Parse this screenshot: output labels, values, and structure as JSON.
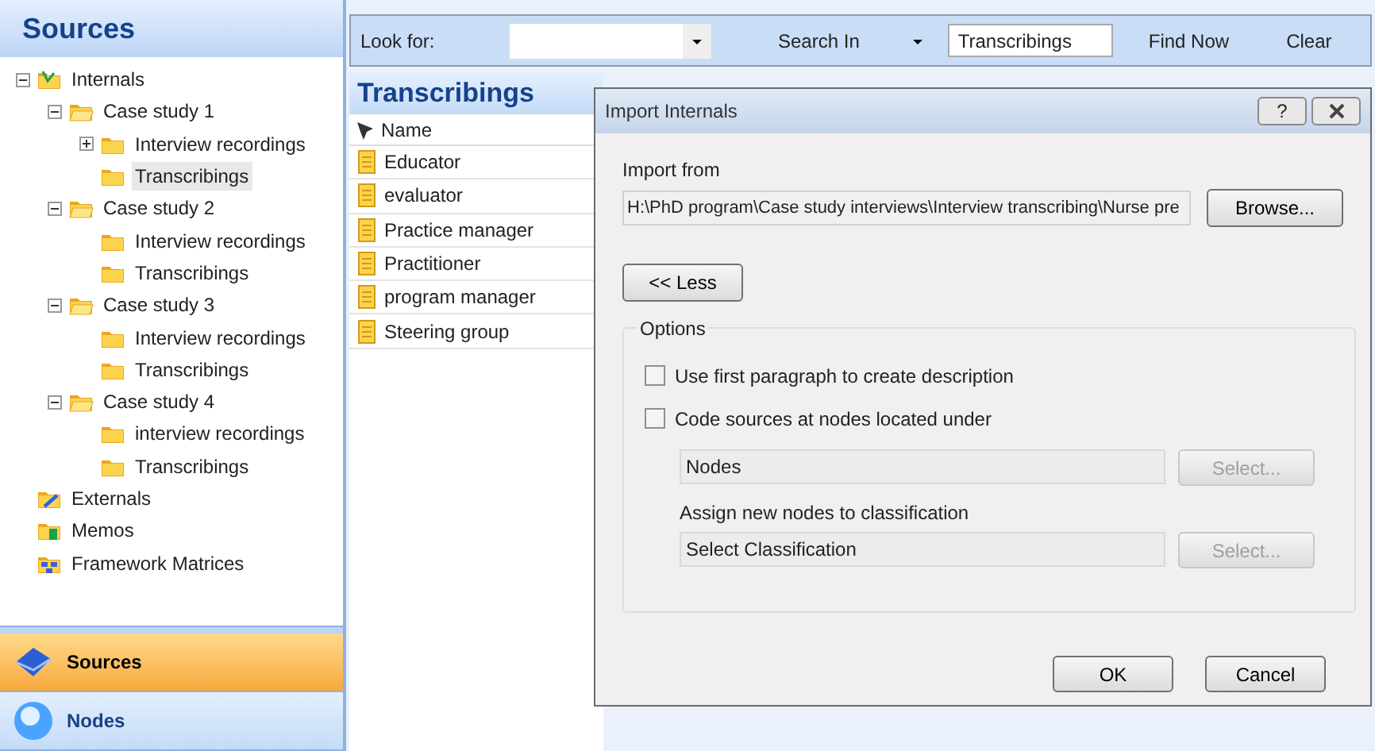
{
  "sidebar": {
    "title": "Sources",
    "tree": [
      {
        "label": "Internals",
        "kind": "root",
        "expanded": true,
        "selected": false,
        "children": [
          {
            "label": "Case study 1",
            "kind": "open",
            "expanded": true,
            "selected": false,
            "children": [
              {
                "label": "Interview recordings",
                "kind": "folder",
                "expanded": false,
                "selected": false
              },
              {
                "label": "Transcribings",
                "kind": "folder",
                "selected": true
              }
            ]
          },
          {
            "label": "Case study 2",
            "kind": "open",
            "expanded": true,
            "selected": false,
            "children": [
              {
                "label": "Interview recordings",
                "kind": "folder",
                "selected": false
              },
              {
                "label": "Transcribings",
                "kind": "folder",
                "selected": false
              }
            ]
          },
          {
            "label": "Case study 3",
            "kind": "open",
            "expanded": true,
            "selected": false,
            "children": [
              {
                "label": "Interview recordings",
                "kind": "folder",
                "selected": false
              },
              {
                "label": "Transcribings",
                "kind": "folder",
                "selected": false
              }
            ]
          },
          {
            "label": "Case study 4",
            "kind": "open",
            "expanded": true,
            "selected": false,
            "children": [
              {
                "label": "interview recordings",
                "kind": "folder",
                "selected": false
              },
              {
                "label": "Transcribings",
                "kind": "folder",
                "selected": false
              }
            ]
          }
        ]
      },
      {
        "label": "Externals",
        "kind": "externals",
        "selected": false
      },
      {
        "label": "Memos",
        "kind": "memos",
        "selected": false
      },
      {
        "label": "Framework Matrices",
        "kind": "matrices",
        "selected": false
      }
    ],
    "nav": [
      {
        "label": "Sources",
        "kind": "cube",
        "selected": true
      },
      {
        "label": "Nodes",
        "kind": "sphere",
        "selected": false
      }
    ]
  },
  "toolbar": {
    "look_for_label": "Look for:",
    "search_in_label": "Search In",
    "search_in_value": "Transcribings",
    "find_now": "Find Now",
    "clear": "Clear"
  },
  "list": {
    "title": "Transcribings",
    "columns": [
      "Name"
    ],
    "rows": [
      "Educator",
      "evaluator",
      "Practice manager",
      "Practitioner",
      "program manager",
      "Steering group"
    ]
  },
  "dialog": {
    "title": "Import Internals",
    "help": "?",
    "import_from_label": "Import from",
    "path": "H:\\PhD program\\Case study interviews\\Interview transcribing\\Nurse pre",
    "browse": "Browse...",
    "less": "<< Less",
    "options_label": "Options",
    "checkboxes": [
      {
        "label": "Use first paragraph to create description",
        "checked": false
      },
      {
        "label": "Code sources at nodes located under",
        "checked": false
      }
    ],
    "nodes_value": "Nodes",
    "classification_label": "Assign new nodes to classification",
    "classification_value": "Select Classification",
    "select_buttons": [
      {
        "label": "Select...",
        "disabled": true
      },
      {
        "label": "Select...",
        "disabled": true
      }
    ],
    "ok": "OK",
    "cancel": "Cancel"
  }
}
